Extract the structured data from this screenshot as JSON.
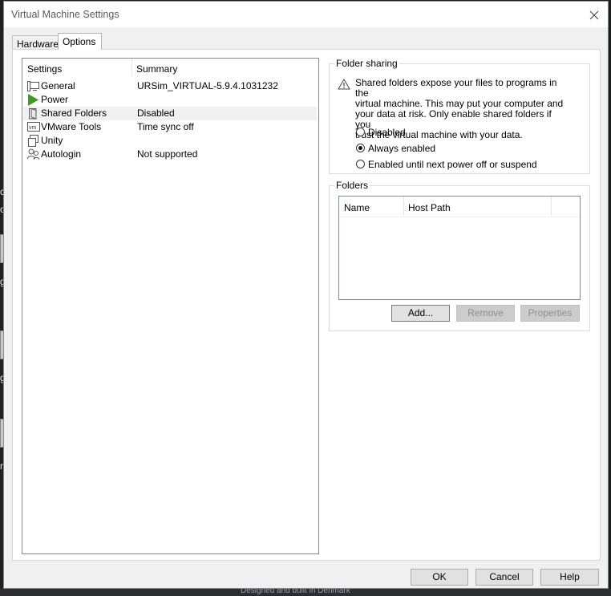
{
  "window": {
    "title": "Virtual Machine Settings"
  },
  "tabs": [
    {
      "label": "Hardware",
      "active": false
    },
    {
      "label": "Options",
      "active": true
    }
  ],
  "settings_list": {
    "columns": [
      "Settings",
      "Summary"
    ],
    "rows": [
      {
        "name": "General",
        "summary": "URSim_VIRTUAL-5.9.4.1031232",
        "icon": "monitor-icon",
        "selected": false
      },
      {
        "name": "Power",
        "summary": "",
        "icon": "play-icon",
        "selected": false
      },
      {
        "name": "Shared Folders",
        "summary": "Disabled",
        "icon": "folder-share-icon",
        "selected": true
      },
      {
        "name": "VMware Tools",
        "summary": "Time sync off",
        "icon": "vm-icon",
        "selected": false
      },
      {
        "name": "Unity",
        "summary": "",
        "icon": "unity-icon",
        "selected": false
      },
      {
        "name": "Autologin",
        "summary": "Not supported",
        "icon": "users-icon",
        "selected": false
      }
    ]
  },
  "folder_sharing": {
    "group_label": "Folder sharing",
    "warning": "Shared folders expose your files to programs in the virtual machine. This may put your computer and your data at risk. Only enable shared folders if you trust the virtual machine with your data.",
    "warning_lines": [
      "Shared folders expose your files to programs in the",
      "virtual machine. This may put your computer and",
      "your data at risk. Only enable shared folders if you",
      "trust the virtual machine with your data."
    ],
    "options": [
      {
        "label": "Disabled",
        "selected": false
      },
      {
        "label": "Always enabled",
        "selected": true
      },
      {
        "label": "Enabled until next power off or suspend",
        "selected": false
      }
    ]
  },
  "folders": {
    "group_label": "Folders",
    "columns": [
      "Name",
      "Host Path"
    ],
    "rows": [],
    "buttons": {
      "add": "Add...",
      "remove": "Remove",
      "properties": "Properties"
    }
  },
  "dialog_buttons": {
    "ok": "OK",
    "cancel": "Cancel",
    "help": "Help"
  },
  "background": {
    "fragments": [
      "c",
      "o",
      "g",
      "g",
      "r"
    ],
    "bottom_text": "Designed and built in Denmark"
  },
  "colors": {
    "window_bg": "#f0f0f0",
    "panel_bg": "#ffffff",
    "power_icon": "#3d9a22",
    "selection": "#f0f0f0"
  }
}
